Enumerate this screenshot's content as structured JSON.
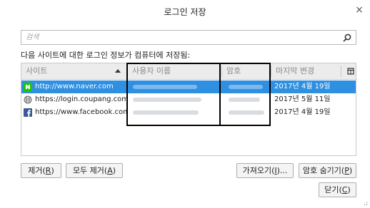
{
  "window": {
    "title": "로그인 저장",
    "close_glyph": "×"
  },
  "search": {
    "placeholder": "검색",
    "value": "",
    "icon": "search-icon"
  },
  "description": "다음 사이트에 대한 로그인 정보가 컴퓨터에 저장됨:",
  "table": {
    "columns": [
      {
        "label": "사이트",
        "sorted": "ascending"
      },
      {
        "label": "사용자 이름"
      },
      {
        "label": "암호"
      },
      {
        "label": "마지막 변경"
      }
    ],
    "column_picker_icon": "column-picker-icon",
    "rows": [
      {
        "site": "http://www.naver.com",
        "favicon": "naver-icon",
        "username": "",
        "password": "",
        "last_changed": "2017년 4월 19일",
        "selected": true
      },
      {
        "site": "https://login.coupang.com",
        "favicon": "globe-icon",
        "username": "",
        "password": "",
        "last_changed": "2017년 5월 11일",
        "selected": false
      },
      {
        "site": "https://www.facebook.com",
        "favicon": "facebook-icon",
        "username": "",
        "password": "",
        "last_changed": "2017년 4월 19일",
        "selected": false
      }
    ]
  },
  "buttons": {
    "remove": {
      "label": "제거(",
      "key": "R",
      "suffix": ")"
    },
    "remove_all": {
      "label": "모두 제거(",
      "key": "A",
      "suffix": ")"
    },
    "import": {
      "label": "가져오기(",
      "key": "I",
      "suffix": ")..."
    },
    "hide_passwords": {
      "label": "암호 숨기기(",
      "key": "P",
      "suffix": ")"
    },
    "close": {
      "label": "닫기(",
      "key": "C",
      "suffix": ")"
    }
  },
  "colors": {
    "selection": "#2f8fe0",
    "header_bg": "#ececec",
    "naver_green": "#1ec800",
    "facebook_blue": "#3b5998"
  }
}
